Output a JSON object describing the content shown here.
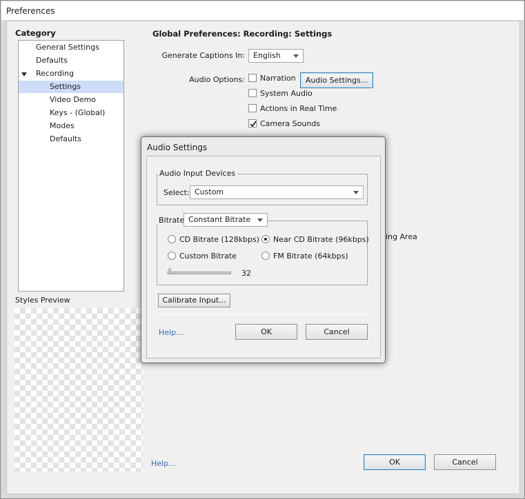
{
  "window": {
    "title": "Preferences"
  },
  "category": {
    "title": "Category",
    "items": [
      {
        "label": "General Settings"
      },
      {
        "label": "Defaults"
      },
      {
        "label": "Recording"
      },
      {
        "label": "Settings"
      },
      {
        "label": "Video Demo"
      },
      {
        "label": "Keys - (Global)"
      },
      {
        "label": "Modes"
      },
      {
        "label": "Defaults"
      }
    ],
    "selected": "Settings"
  },
  "styles_preview": {
    "label": "Styles Preview"
  },
  "settings": {
    "title": "Global Preferences: Recording: Settings",
    "captions_label": "Generate Captions In:",
    "captions_value": "English",
    "audio_options_label": "Audio Options:",
    "narration": {
      "label": "Narration",
      "checked": false
    },
    "audio_settings_button": "Audio Settings...",
    "system_audio": {
      "label": "System Audio",
      "checked": false
    },
    "actions_real_time": {
      "label": "Actions in Real Time",
      "checked": false
    },
    "camera_sounds": {
      "label": "Camera Sounds",
      "checked": true
    },
    "partial_text": "ing Area"
  },
  "footer": {
    "help": "Help...",
    "ok": "OK",
    "cancel": "Cancel"
  },
  "audio_dialog": {
    "title": "Audio Settings",
    "input_devices_legend": "Audio Input Devices",
    "select_label": "Select:",
    "select_value": "Custom",
    "bitrate_label": "Bitrate",
    "bitrate_value": "Constant Bitrate",
    "options": [
      {
        "label": "CD Bitrate (128kbps)",
        "selected": false
      },
      {
        "label": "Near CD Bitrate (96kbps)",
        "selected": true
      },
      {
        "label": "Custom Bitrate",
        "selected": false
      },
      {
        "label": "FM Bitrate (64kbps)",
        "selected": false
      }
    ],
    "slider_value": "32",
    "calibrate_button": "Calibrate Input...",
    "help": "Help...",
    "ok": "OK",
    "cancel": "Cancel"
  }
}
